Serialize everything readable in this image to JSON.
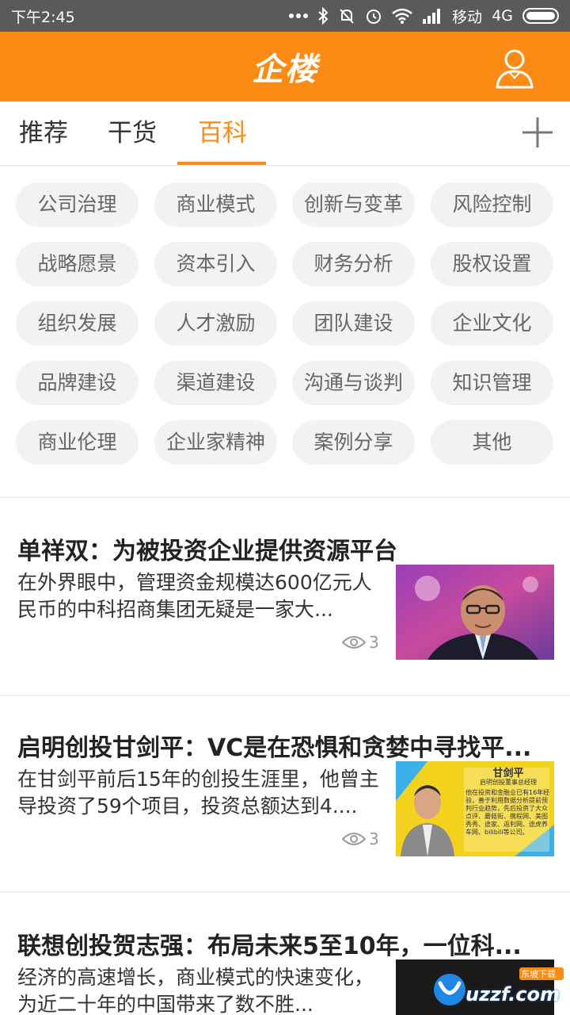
{
  "status_bar": {
    "time": "下午2:45",
    "carrier": "移动",
    "network": "4G"
  },
  "header": {
    "logo": "企楼",
    "user_icon": "user-icon"
  },
  "tabs": [
    {
      "label": "推荐",
      "active": false
    },
    {
      "label": "干货",
      "active": false
    },
    {
      "label": "百科",
      "active": true
    }
  ],
  "accent_color": "#fb8b14",
  "categories": [
    "公司治理",
    "商业模式",
    "创新与变革",
    "风险控制",
    "战略愿景",
    "资本引入",
    "财务分析",
    "股权设置",
    "组织发展",
    "人才激励",
    "团队建设",
    "企业文化",
    "品牌建设",
    "渠道建设",
    "沟通与谈判",
    "知识管理",
    "商业伦理",
    "企业家精神",
    "案例分享",
    "其他"
  ],
  "articles": [
    {
      "title": "单祥双：为被投资企业提供资源平台",
      "summary": "在外界眼中，管理资金规模达600亿元人民币的中科招商集团无疑是一家大...",
      "views": "3"
    },
    {
      "title": "启明创投甘剑平：VC是在恐惧和贪婪中寻找平...",
      "summary": "在甘剑平前后15年的创投生涯里，他曾主导投资了59个项目，投资总额达到4....",
      "views": "3",
      "thumb_caption": {
        "name": "甘剑平",
        "role": "启明创投董事总经理",
        "bio": "他在投资和金融业已有16年经验，善于利用数据分析提前预判行业趋势，先后投资了大众点评、蘑菇街、携程网、美图秀秀、途家、返利网、途虎养车网、bilibili等公司。"
      }
    },
    {
      "title": "联想创投贺志强：布局未来5至10年，一位科...",
      "summary": "经济的高速增长，商业模式的快速变化，为近二十年的中国带来了数不胜...",
      "views": ""
    }
  ],
  "watermark": {
    "text": "uzzf.com",
    "tag": "东坡下载"
  }
}
